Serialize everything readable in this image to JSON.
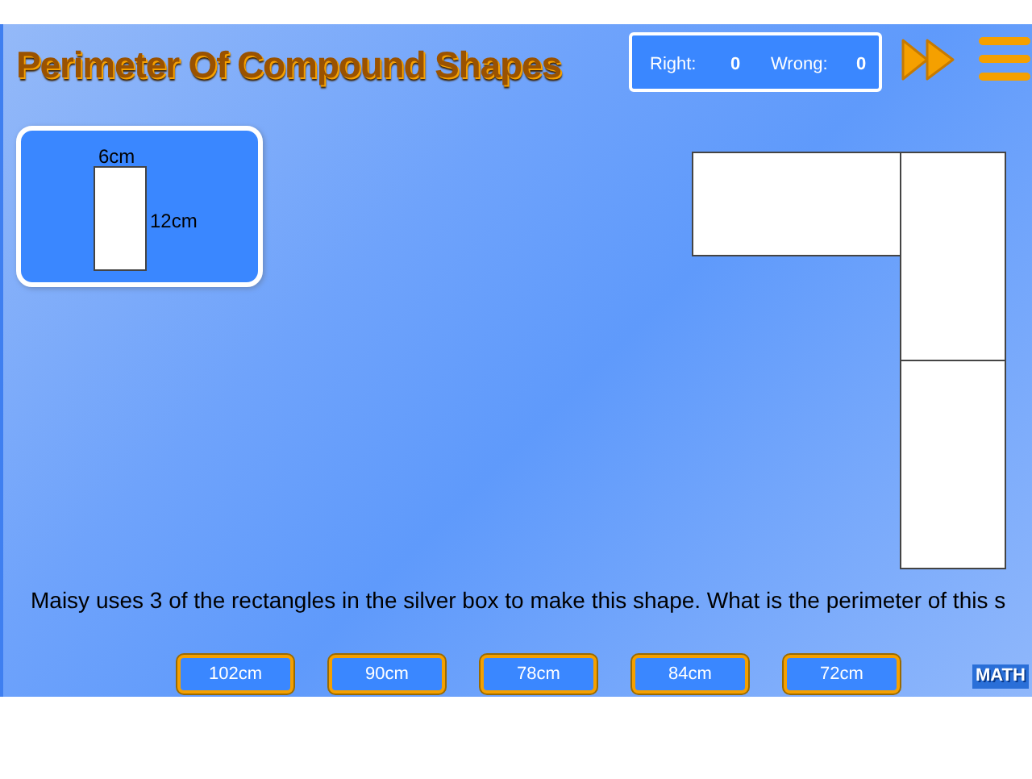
{
  "title": "Perimeter Of Compound Shapes",
  "score": {
    "right_label": "Right:",
    "right_value": "0",
    "wrong_label": "Wrong:",
    "wrong_value": "0"
  },
  "sample_rectangle": {
    "width_label": "6cm",
    "height_label": "12cm"
  },
  "question": "Maisy uses 3 of the rectangles in the silver box to make this shape. What is the perimeter of this s",
  "answers": [
    {
      "label": "102cm"
    },
    {
      "label": "90cm"
    },
    {
      "label": "78cm"
    },
    {
      "label": "84cm"
    },
    {
      "label": "72cm"
    }
  ],
  "logo": "MATH"
}
